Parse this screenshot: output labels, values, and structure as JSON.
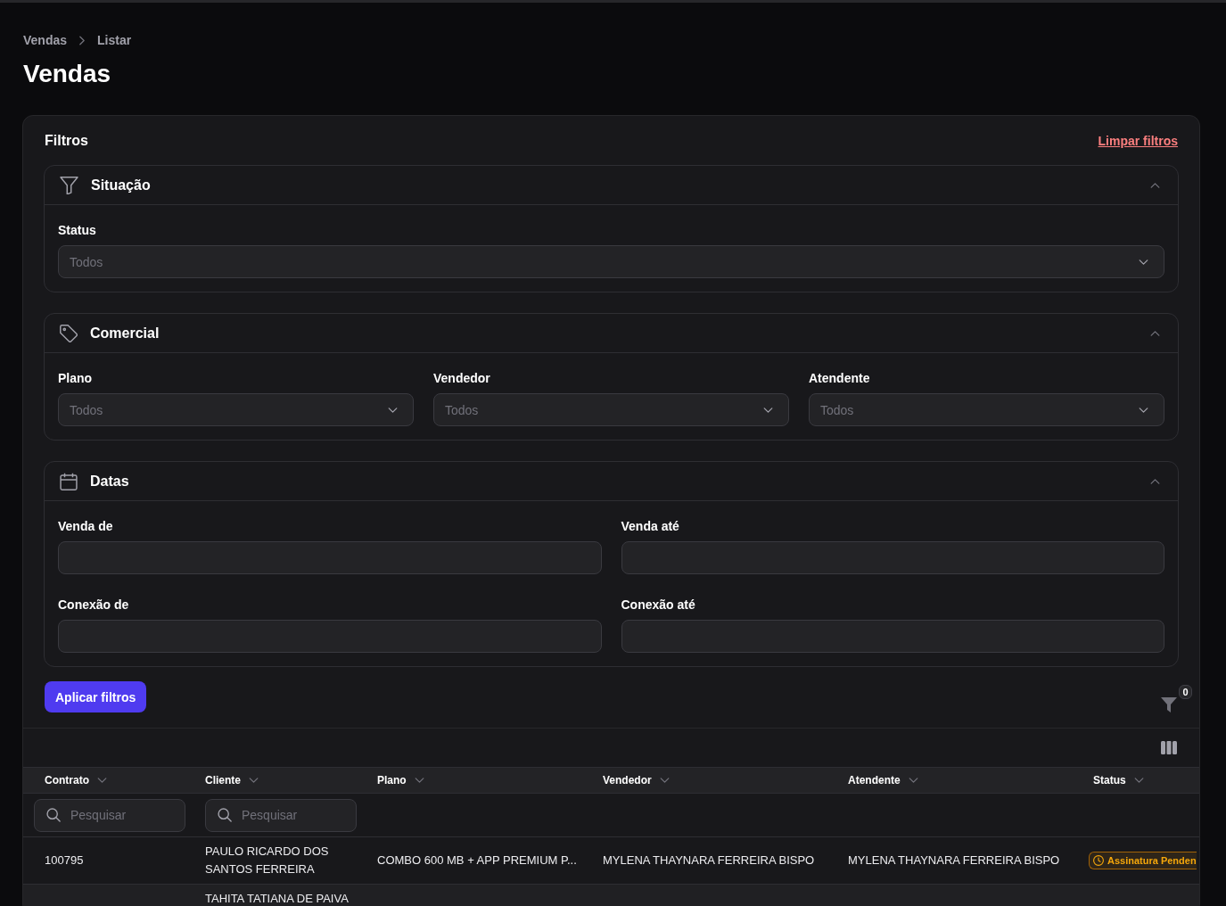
{
  "breadcrumb": [
    {
      "label": "Vendas"
    },
    {
      "label": "Listar"
    }
  ],
  "title": "Vendas",
  "filters": {
    "title": "Filtros",
    "clear_link": "Limpar filtros",
    "sections": [
      {
        "title": "Situação",
        "expanded": true,
        "rows": [
          [
            {
              "label": "Status",
              "kind": "select",
              "placeholder": "Todos"
            }
          ]
        ]
      },
      {
        "title": "Comercial",
        "expanded": true,
        "rows": [
          [
            {
              "label": "Plano",
              "kind": "select",
              "placeholder": "Todos"
            },
            {
              "label": "Vendedor",
              "kind": "select",
              "placeholder": "Todos"
            },
            {
              "label": "Atendente",
              "kind": "select",
              "placeholder": "Todos"
            }
          ]
        ]
      },
      {
        "title": "Datas",
        "expanded": true,
        "rows": [
          [
            {
              "label": "Venda de",
              "kind": "date"
            },
            {
              "label": "Venda até",
              "kind": "date"
            }
          ],
          [
            {
              "label": "Conexão de",
              "kind": "date"
            },
            {
              "label": "Conexão até",
              "kind": "date"
            }
          ]
        ]
      }
    ],
    "apply_button": "Aplicar filtros",
    "active_count": "0"
  },
  "table": {
    "columns": [
      {
        "label": "Contrato",
        "search_placeholder": "Pesquisar"
      },
      {
        "label": "Cliente",
        "search_placeholder": "Pesquisar"
      },
      {
        "label": "Plano"
      },
      {
        "label": "Vendedor"
      },
      {
        "label": "Atendente"
      },
      {
        "label": "Status"
      }
    ],
    "rows": [
      {
        "contrato": "100795",
        "cliente": "PAULO RICARDO DOS SANTOS FERREIRA",
        "plano": "COMBO 600 MB + APP PREMIUM P...",
        "vendedor": "MYLENA THAYNARA FERREIRA BISPO",
        "atendente": "MYLENA THAYNARA FERREIRA BISPO",
        "status": "Assinatura Penden"
      },
      {
        "cliente": "TAHITA TATIANA DE PAIVA"
      }
    ]
  }
}
